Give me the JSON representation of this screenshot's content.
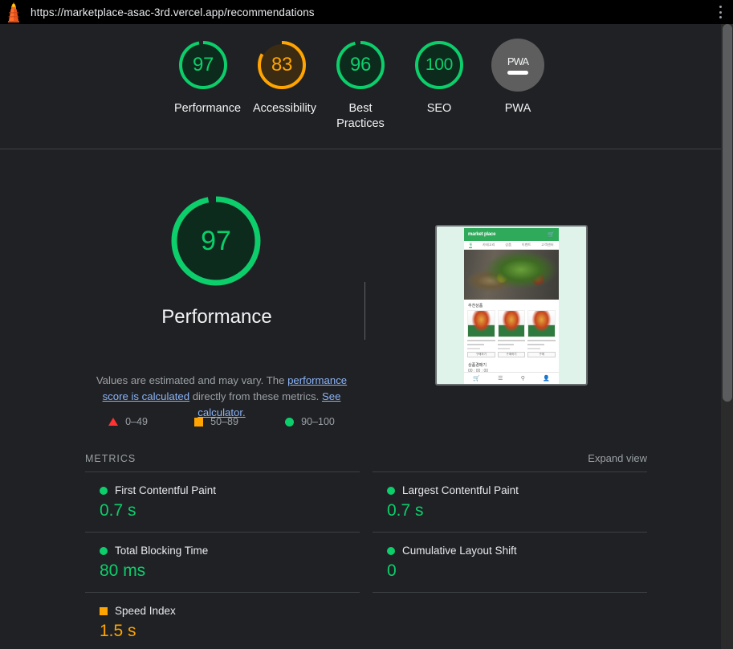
{
  "browser": {
    "url": "https://marketplace-asac-3rd.vercel.app/recommendations",
    "brand_icon": "lighthouse-icon",
    "menu_icon": "kebab-menu-icon"
  },
  "scores": [
    {
      "label": "Performance",
      "value": "97",
      "percent": 97,
      "state": "pass"
    },
    {
      "label": "Accessibility",
      "value": "83",
      "percent": 83,
      "state": "average"
    },
    {
      "label": "Best Practices",
      "value": "96",
      "percent": 96,
      "state": "pass"
    },
    {
      "label": "SEO",
      "value": "100",
      "percent": 100,
      "state": "pass"
    },
    {
      "label": "PWA",
      "value": "PWA",
      "percent": 0,
      "state": "null"
    }
  ],
  "main": {
    "gauge_value": "97",
    "gauge_percent": 97,
    "title": "Performance",
    "estimate_prefix": "Values are estimated and may vary. The ",
    "estimate_link1": "performance score is calculated",
    "estimate_middle": " directly from these metrics. ",
    "estimate_link2": "See calculator."
  },
  "legend": [
    {
      "icon": "triangle",
      "range": "0–49",
      "color": "#ff3333"
    },
    {
      "icon": "square",
      "range": "50–89",
      "color": "#ffa400"
    },
    {
      "icon": "circle",
      "range": "90–100",
      "color": "#0cce6b"
    }
  ],
  "metrics_section": {
    "label": "METRICS",
    "expand_view": "Expand view"
  },
  "metrics": [
    {
      "name": "First Contentful Paint",
      "value": "0.7 s",
      "state": "pass"
    },
    {
      "name": "Largest Contentful Paint",
      "value": "0.7 s",
      "state": "pass"
    },
    {
      "name": "Total Blocking Time",
      "value": "80 ms",
      "state": "pass"
    },
    {
      "name": "Cumulative Layout Shift",
      "value": "0",
      "state": "pass"
    },
    {
      "name": "Speed Index",
      "value": "1.5 s",
      "state": "average"
    }
  ],
  "thumbnail": {
    "site_logo": "market place",
    "cart_icon": "shopping-cart-icon",
    "nav": [
      "홈",
      "카테고리",
      "상품",
      "이벤트",
      "고객센터"
    ],
    "section_title": "추천상품",
    "cards": [
      {
        "title": "[산지직송] 프리미엄 유기농 성우 모음",
        "brand": "marketing",
        "price": "12,900원",
        "button": "구매하기"
      },
      {
        "title": "신선한생각 유기농 채소 세트",
        "brand": "marketing",
        "price": "15,900원",
        "button": "구매하기"
      },
      {
        "title": "프리미엄 샐러드 패키지",
        "brand": "marketing",
        "price": "9,900원",
        "button": "구매"
      }
    ],
    "footer_title": "상품경매기",
    "footer_sub": "00 : 00 : 00",
    "tabbar_icons": [
      "home-icon",
      "list-icon",
      "search-icon",
      "profile-icon"
    ]
  },
  "colors": {
    "pass": "#0cce6b",
    "average": "#ffa400",
    "fail": "#ff3333",
    "pass_bg": "#0d2b1c",
    "average_bg": "#3a2b12",
    "background": "#202124",
    "link": "#8ab4f8"
  }
}
